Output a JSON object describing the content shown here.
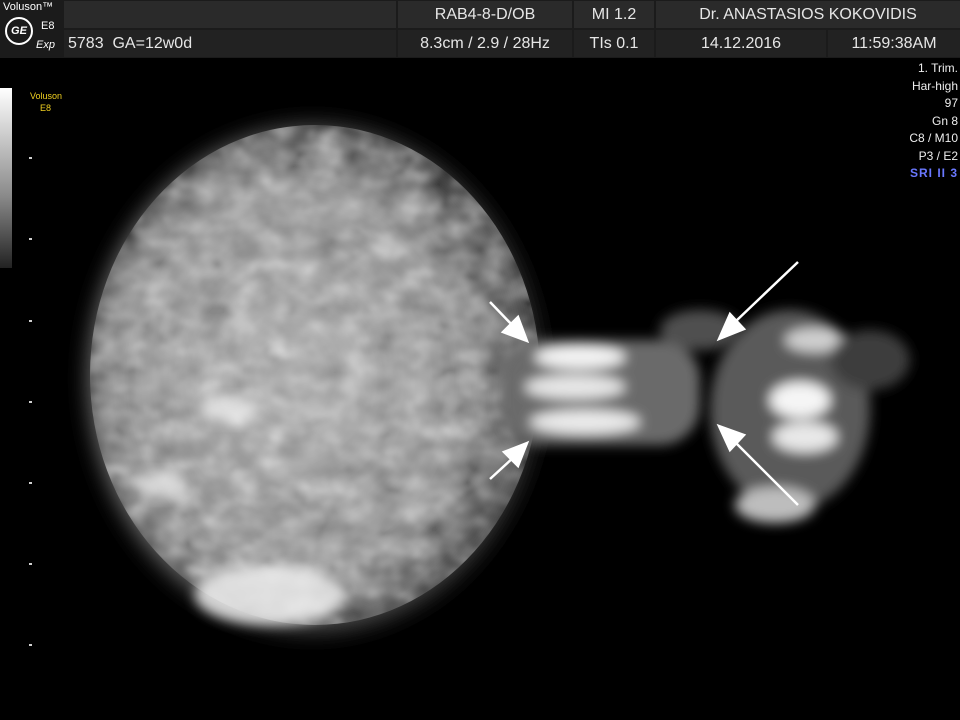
{
  "header": {
    "brand": "Voluson™",
    "logo_text": "GE",
    "model": "E8",
    "model_suffix": "Exp",
    "patient_id": "5783",
    "gestational_age": "GA=12w0d",
    "probe": "RAB4-8-D/OB",
    "depth_info": "8.3cm / 2.9 / 28Hz",
    "mi": "MI  1.2",
    "tis": "TIs  0.1",
    "doctor": "Dr. ANASTASIOS KOKOVIDIS",
    "date": "14.12.2016",
    "time": "11:59:38AM"
  },
  "sidebar": {
    "label_line1": "Voluson",
    "label_line2": "E8"
  },
  "params": {
    "preset": "1. Trim.",
    "harmonic": "Har-high",
    "power": "97",
    "gain": "Gn  8",
    "c_m": "C8 / M10",
    "p_e": "P3 / E2",
    "sri": "SRI II 3"
  },
  "colors": {
    "header_bg": "#2a2a2a",
    "label_yellow": "#f0d020",
    "sri_blue": "#6a78ff",
    "arrow": "#ffffff"
  },
  "image": {
    "content": "3D ultrasound rendering of a fetal head with arrows indicating structure"
  }
}
